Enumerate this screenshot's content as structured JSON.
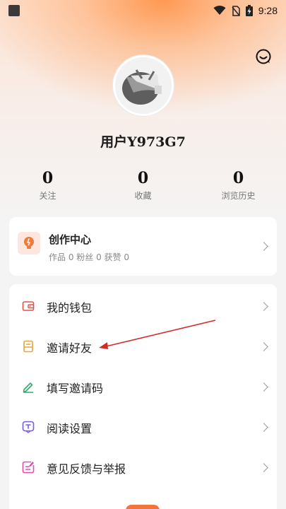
{
  "status_bar": {
    "time": "9:28"
  },
  "profile": {
    "username": "用户Y973G7"
  },
  "stats": [
    {
      "value": "0",
      "label": "关注"
    },
    {
      "value": "0",
      "label": "收藏"
    },
    {
      "value": "0",
      "label": "浏览历史"
    }
  ],
  "creator": {
    "title": "创作中心",
    "subtitle": "作品 0 粉丝 0 获赞 0",
    "icon": "lightbulb-icon"
  },
  "menu": [
    {
      "label": "我的钱包",
      "icon": "wallet-icon",
      "color": "#e0554a"
    },
    {
      "label": "邀请好友",
      "icon": "invite-icon",
      "color": "#e8a43a"
    },
    {
      "label": "填写邀请码",
      "icon": "pen-icon",
      "color": "#2fae6a"
    },
    {
      "label": "阅读设置",
      "icon": "reading-settings-icon",
      "color": "#7b5be0"
    },
    {
      "label": "意见反馈与举报",
      "icon": "feedback-icon",
      "color": "#e04fb0"
    }
  ],
  "colors": {
    "accent": "#f2743a",
    "annotation_arrow": "#d42a2a"
  }
}
